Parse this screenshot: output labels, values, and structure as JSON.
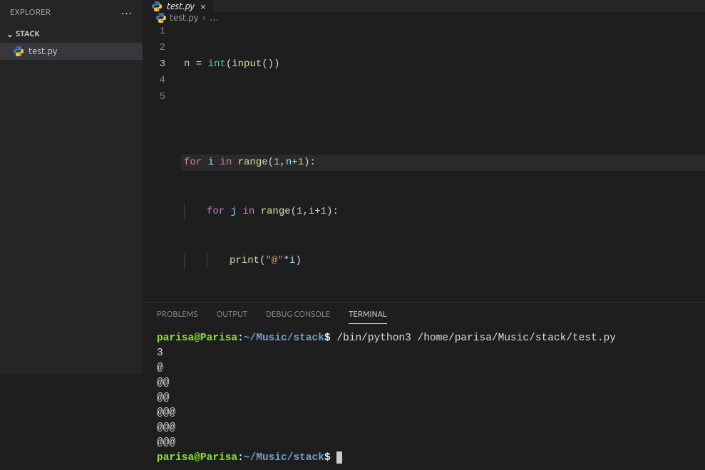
{
  "explorer": {
    "title": "EXPLORER"
  },
  "sidebar": {
    "section": "STACK",
    "items": [
      {
        "name": "test.py"
      }
    ]
  },
  "tab": {
    "name": "test.py",
    "close": "×"
  },
  "breadcrumb": {
    "file": "test.py",
    "sep": "›",
    "more": "…"
  },
  "code": {
    "lines": [
      "1",
      "2",
      "3",
      "4",
      "5"
    ],
    "l1": {
      "v": "n",
      "eq": " = ",
      "int": "int",
      "op": "(",
      "inp": "input",
      "cp": "())"
    },
    "l3": {
      "for": "for ",
      "i": "i",
      "in": " in ",
      "range": "range",
      "op": "(",
      "n1": "1",
      "c": ",",
      "v": "n",
      "plus": "+",
      "n2": "1",
      "cp": "):"
    },
    "l4": {
      "for": "for ",
      "j": "j",
      "in": " in ",
      "range": "range",
      "op": "(",
      "n1": "1",
      "c": ",",
      "v": "i",
      "plus": "+",
      "n2": "1",
      "cp": "):"
    },
    "l5": {
      "print": "print",
      "op": "(",
      "s": "\"@\"",
      "star": "*",
      "v": "i",
      "cp": ")"
    }
  },
  "panel": {
    "tabs": [
      "PROBLEMS",
      "OUTPUT",
      "DEBUG CONSOLE",
      "TERMINAL"
    ],
    "active": 3
  },
  "terminal": {
    "user": "parisa",
    "at": "@",
    "host": "Parisa",
    "colon": ":",
    "path": "~/Music/stack",
    "dollar": "$ ",
    "cmd": "/bin/python3 /home/parisa/Music/stack/test.py",
    "out": [
      "3",
      "@",
      "@@",
      "@@",
      "@@@",
      "@@@",
      "@@@"
    ]
  }
}
